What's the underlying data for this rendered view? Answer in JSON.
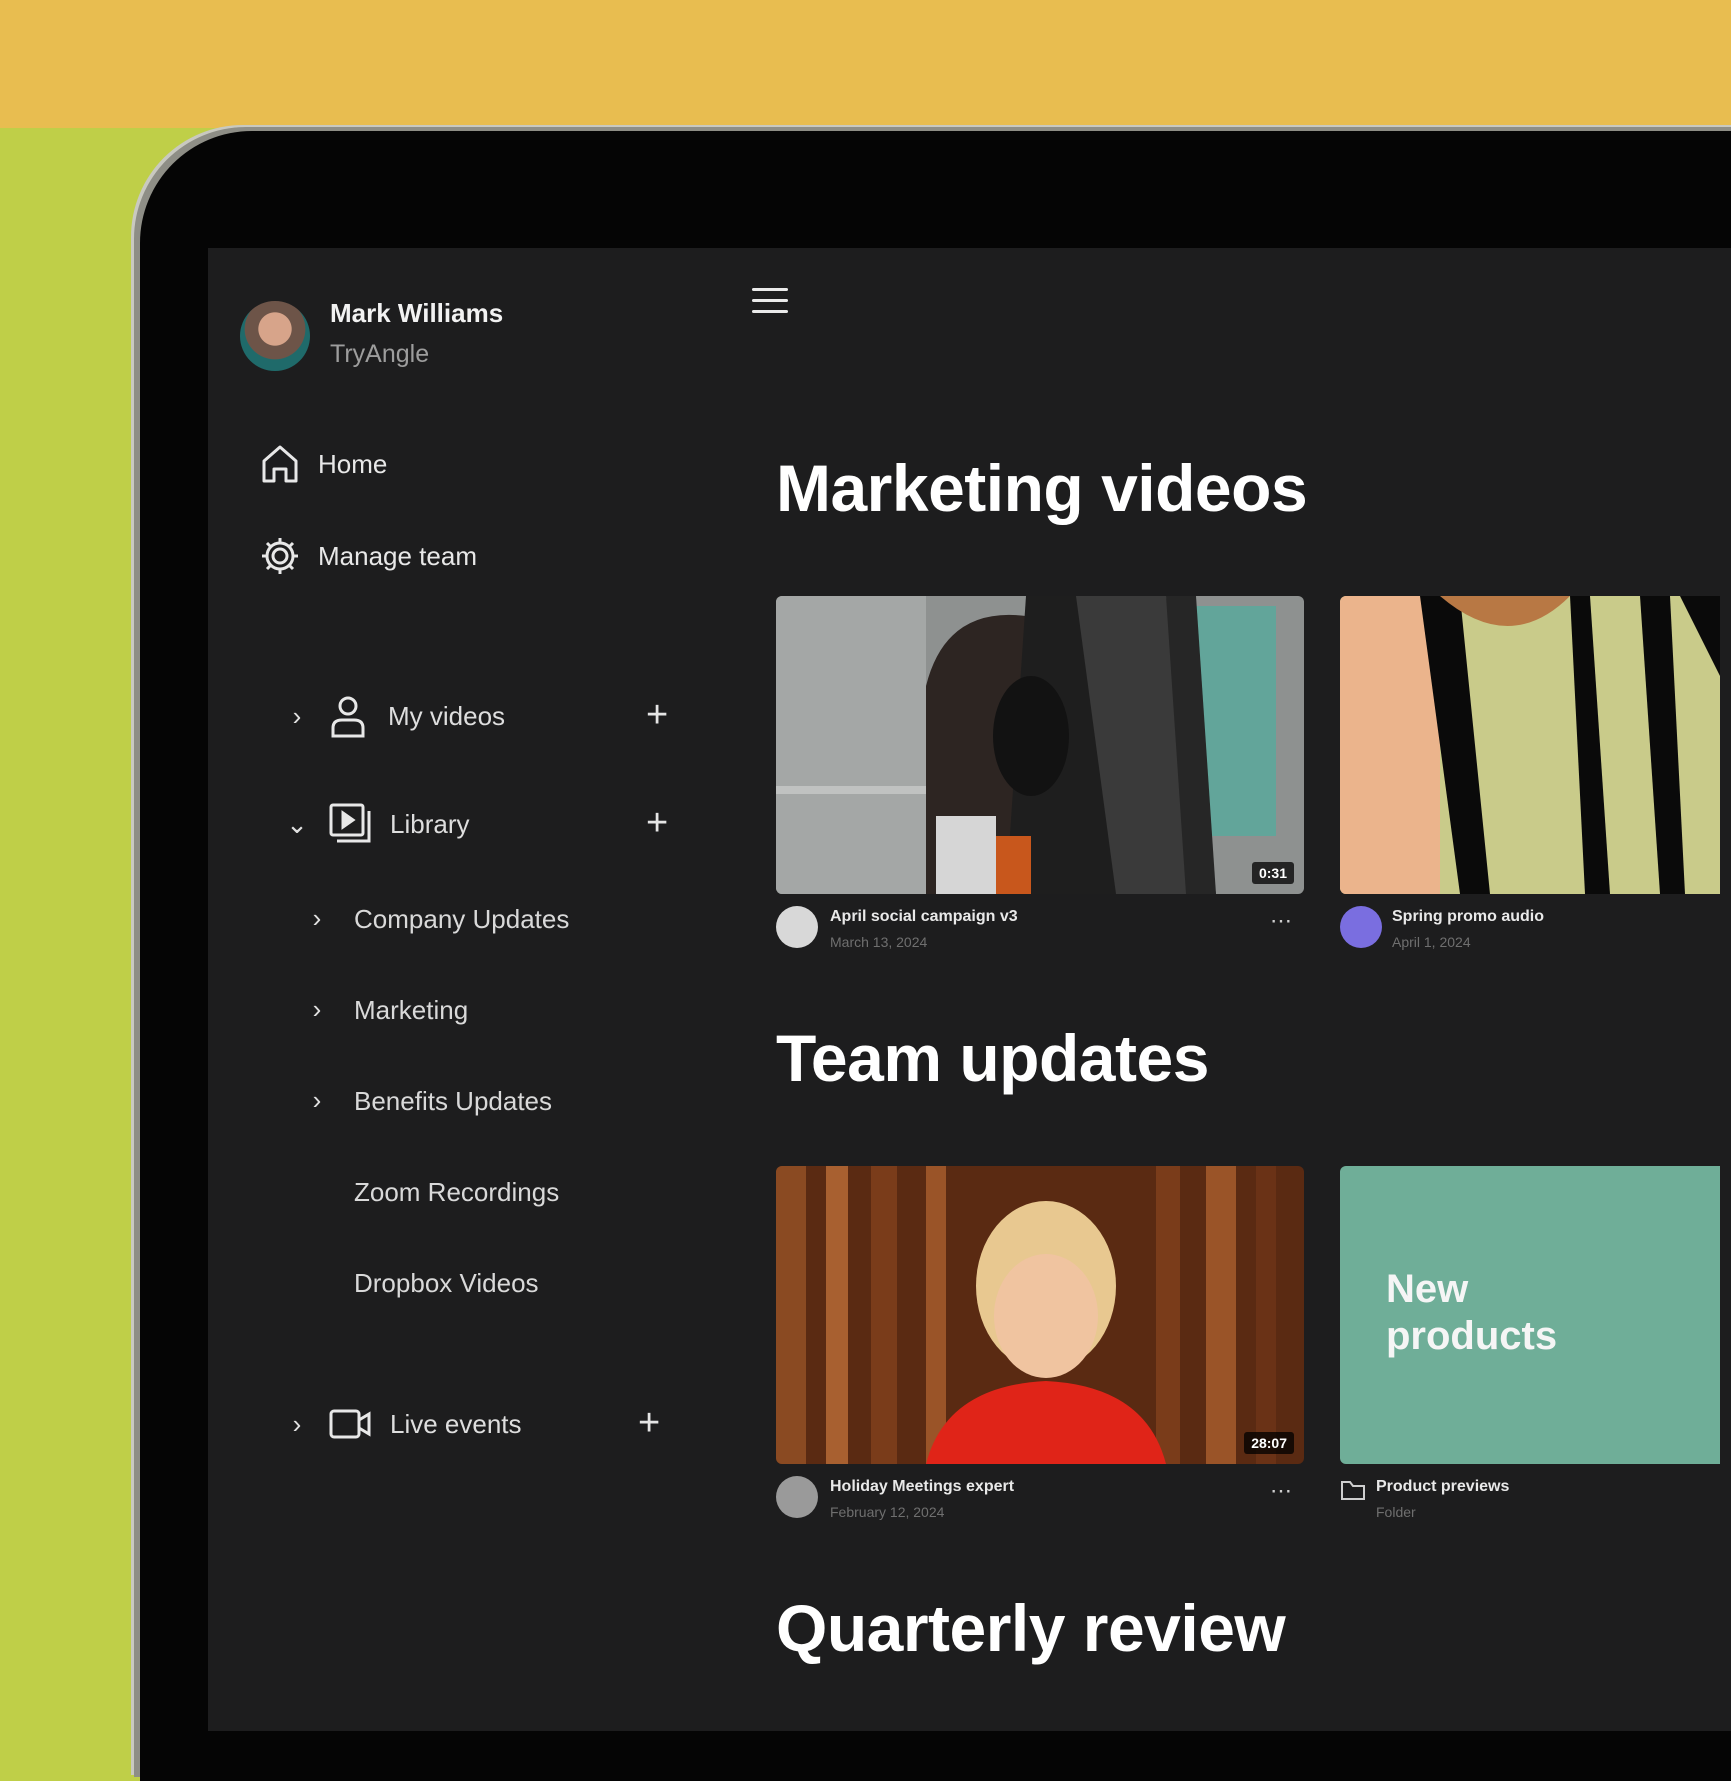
{
  "user": {
    "name": "Mark Williams",
    "org": "TryAngle"
  },
  "nav": [
    {
      "label": "Home",
      "icon": "home-icon"
    },
    {
      "label": "Manage team",
      "icon": "gear-icon"
    }
  ],
  "tree": {
    "my_videos": {
      "label": "My videos",
      "icon": "person-icon"
    },
    "library": {
      "label": "Library",
      "icon": "library-icon",
      "children": [
        {
          "label": "Company Updates",
          "has_children": true
        },
        {
          "label": "Marketing",
          "has_children": true
        },
        {
          "label": "Benefits Updates",
          "has_children": true
        },
        {
          "label": "Zoom Recordings",
          "has_children": false
        },
        {
          "label": "Dropbox Videos",
          "has_children": false
        }
      ]
    },
    "live_events": {
      "label": "Live events",
      "icon": "video-camera-icon"
    }
  },
  "sections": [
    {
      "title": "Marketing videos",
      "videos": [
        {
          "title": "April social campaign v3",
          "sub": "March 13, 2024",
          "duration": "0:31"
        },
        {
          "title": "Spring promo audio",
          "sub": "April 1, 2024"
        }
      ]
    },
    {
      "title": "Team updates",
      "videos": [
        {
          "title": "Holiday Meetings expert",
          "sub": "February 12, 2024",
          "duration": "28:07"
        },
        {
          "title": "Product previews",
          "sub": "Folder",
          "tile_text": "New\nproducts"
        }
      ]
    },
    {
      "title": "Quarterly review",
      "videos": []
    }
  ],
  "colors": {
    "background_green": "#bfcf48",
    "background_yellow": "#e8bd50",
    "screen": "#1d1d1e",
    "tile_teal": "#6fae98"
  }
}
